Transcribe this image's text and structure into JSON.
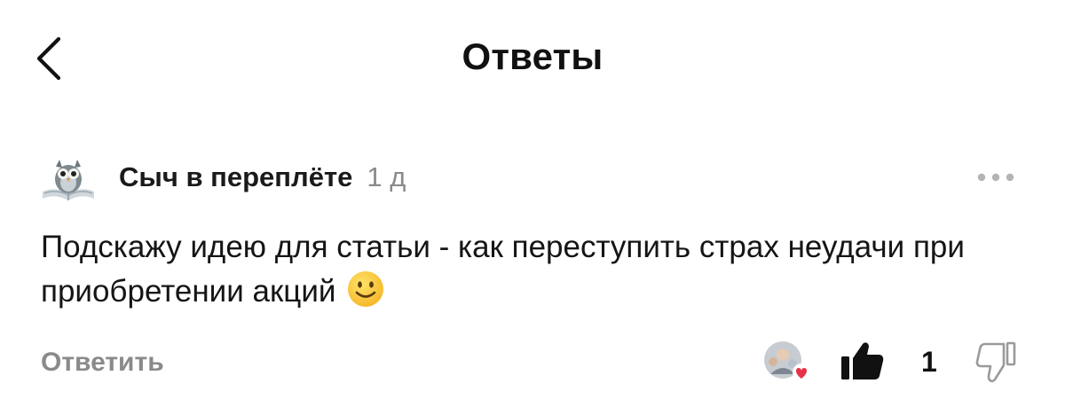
{
  "header": {
    "title": "Ответы",
    "back_icon": "chevron-left-icon"
  },
  "comment": {
    "author": "Сыч в переплёте",
    "time": "1 д",
    "text": "Подскажу идею для статьи - как переступить страх неудачи при приобретении акций",
    "emoji": "slightly-smiling-face",
    "more_icon": "more-dots-icon",
    "reply_label": "Ответить",
    "like_count": "1",
    "liked_by_author": true,
    "icons": {
      "avatar": "owl-reading-book-avatar",
      "reactor": "reactor-avatar-with-heart",
      "like": "thumbs-up-icon",
      "dislike": "thumbs-down-icon"
    },
    "colors": {
      "heart": "#e8314a",
      "muted_text": "#8a8a8a"
    }
  }
}
